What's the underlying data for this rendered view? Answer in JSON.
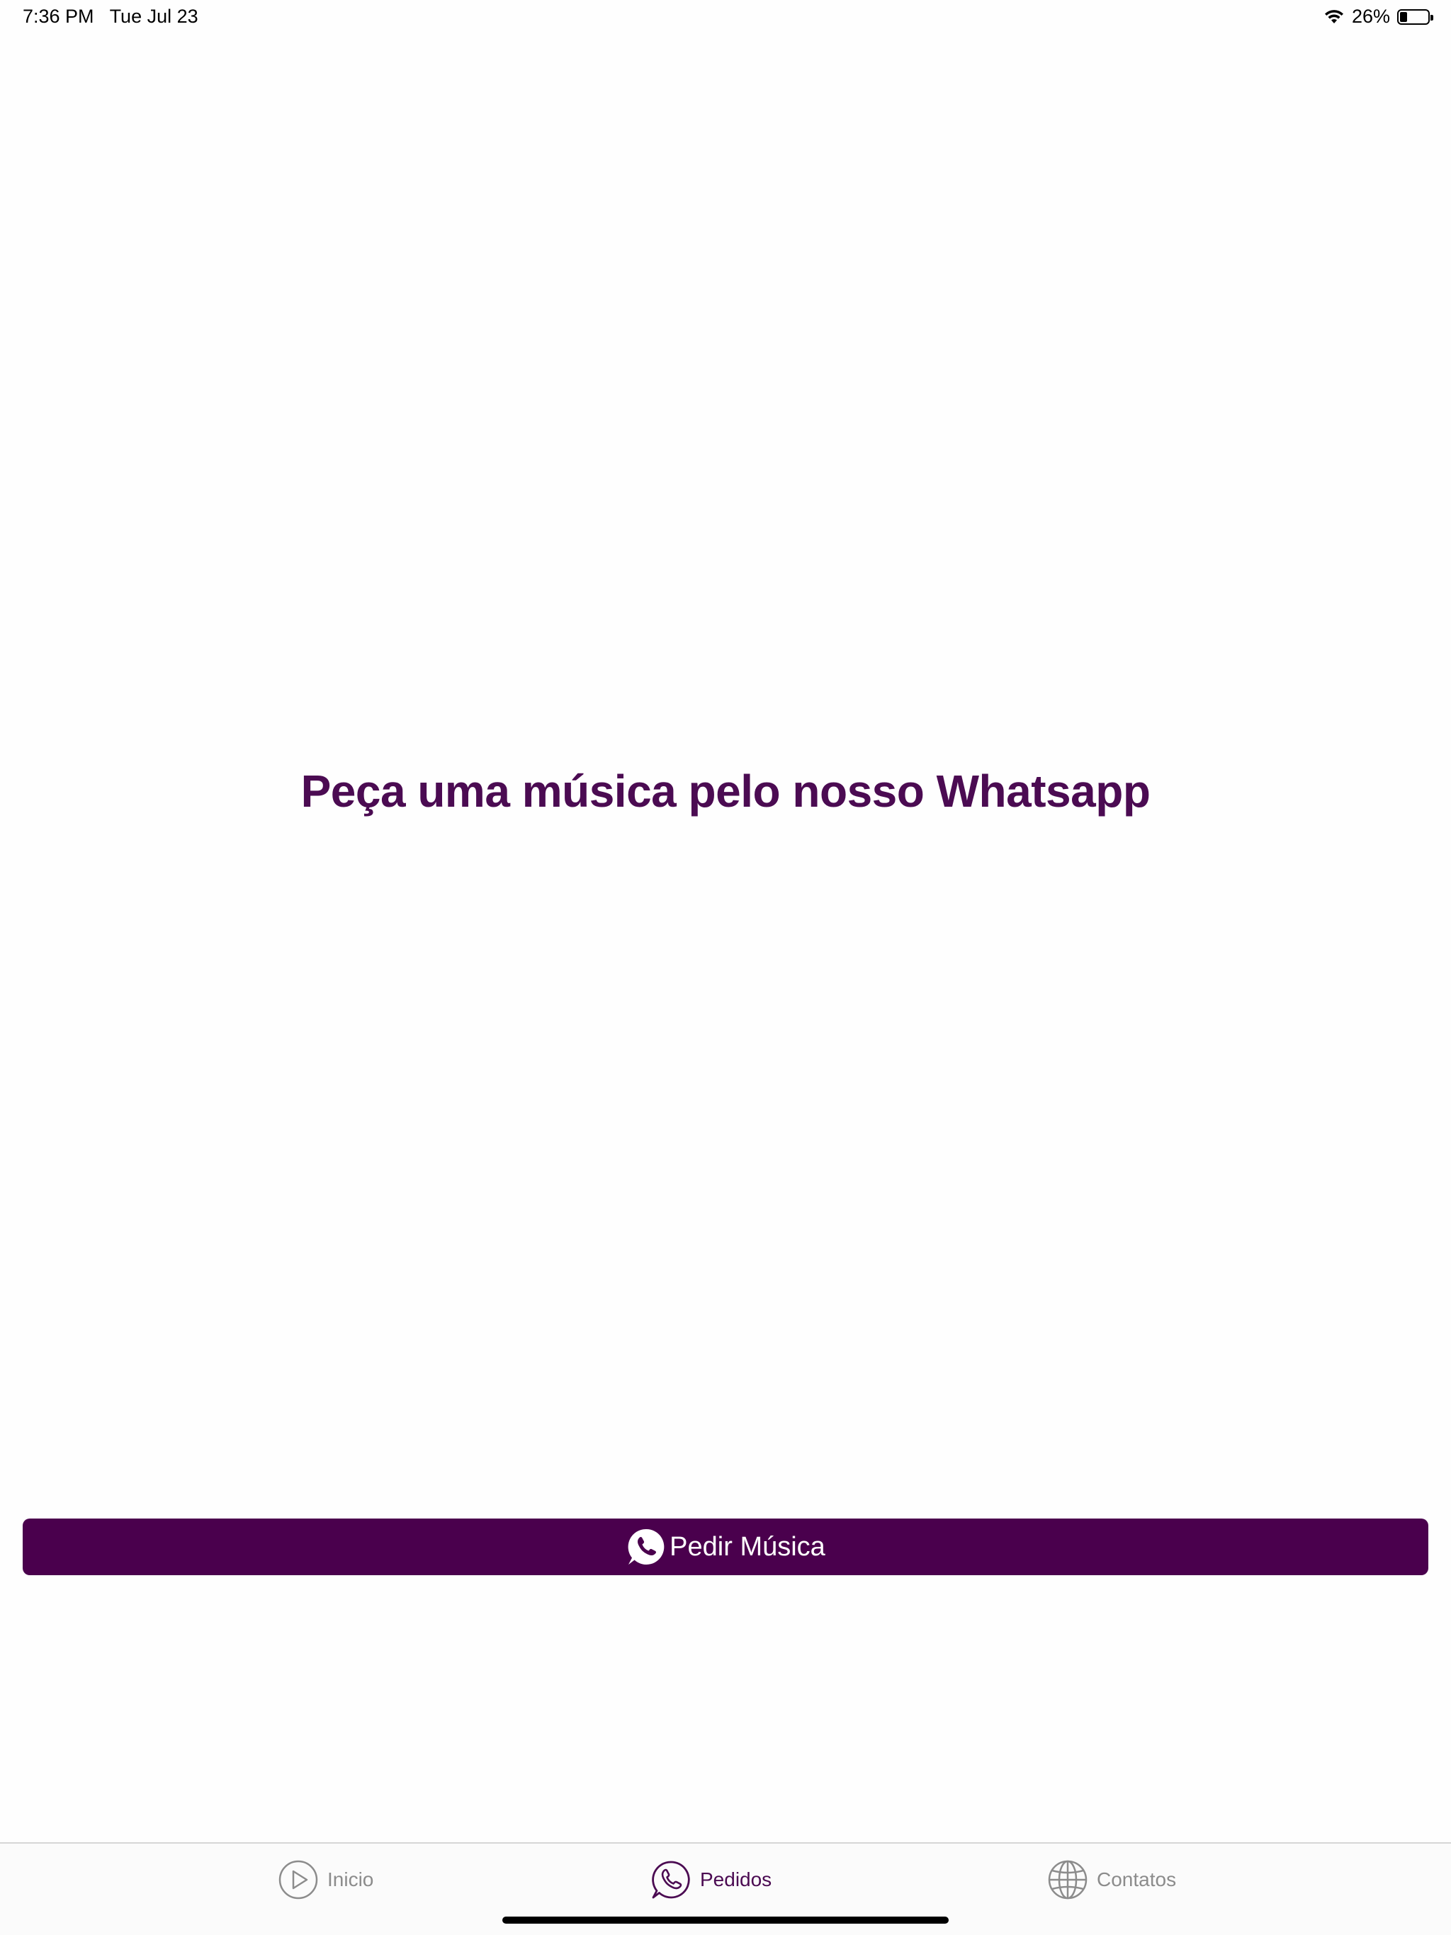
{
  "status_bar": {
    "time": "7:36 PM",
    "date": "Tue Jul 23",
    "battery_text": "26%",
    "battery_level": 0.26,
    "wifi_icon": "wifi-icon"
  },
  "main": {
    "heading": "Peça uma música pelo nosso Whatsapp",
    "heading_color": "#4b0b52"
  },
  "request_button": {
    "label": "Pedir Música",
    "icon": "whatsapp-icon",
    "background": "#4a004d"
  },
  "tab_bar": {
    "tabs": [
      {
        "label": "Inicio",
        "icon": "play-circle-icon",
        "active": false
      },
      {
        "label": "Pedidos",
        "icon": "whatsapp-icon",
        "active": true
      },
      {
        "label": "Contatos",
        "icon": "globe-icon",
        "active": false
      }
    ],
    "active_color": "#4b0b52",
    "inactive_color": "#8c8c8c"
  }
}
